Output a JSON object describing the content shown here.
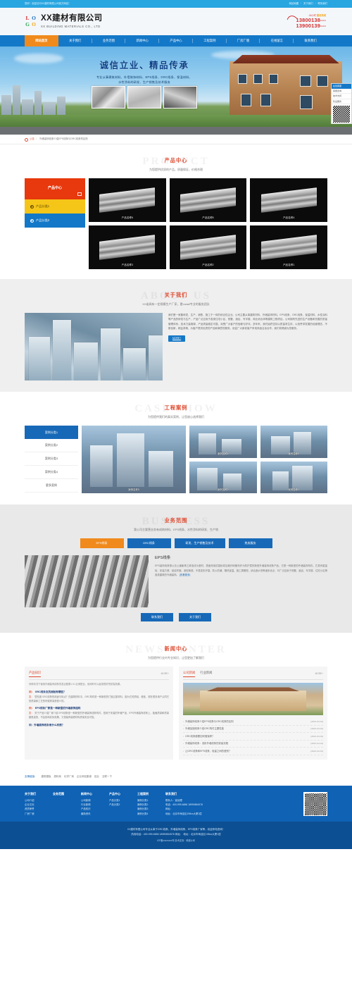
{
  "topbar": {
    "left": "您好！欢迎访问XX建材有限公司官方网站！",
    "links": [
      "网站地图",
      "关于我们",
      "联系我们"
    ]
  },
  "header": {
    "logo_letters": [
      "L",
      "O",
      "G",
      "O"
    ],
    "company_cn": "XX建材有限公司",
    "company_en": "XX BUILDING MATERIALS CO., LTD",
    "hotline_label_1": "24小时",
    "hotline_label_2": "服务热线",
    "hotline_1": "13800138---",
    "hotline_2": "13900139---"
  },
  "nav": [
    {
      "label": "网站首页",
      "active": true
    },
    {
      "label": "关于我们",
      "active": false
    },
    {
      "label": "业务范围",
      "active": false
    },
    {
      "label": "新闻中心",
      "active": false
    },
    {
      "label": "产品中心",
      "active": false
    },
    {
      "label": "工程案例",
      "active": false
    },
    {
      "label": "厂房厂貌",
      "active": false
    },
    {
      "label": "在线留言",
      "active": false
    },
    {
      "label": "联系我们",
      "active": false
    }
  ],
  "banner": {
    "title": "诚信立业、精品传承",
    "subtitle_1": "专业从事建筑材料、外墙装饰材料、EPS线条、GRC线条、保温材料、",
    "subtitle_2": "水性涂料的研发、生产销售及技术服务",
    "side_panel": {
      "header": "在线客服",
      "rows": [
        "客服咨询",
        "技术支持",
        "售后服务"
      ]
    }
  },
  "breadcrumb": {
    "tag": "公告",
    "text": "外墙装饰线条介绍EPS线条与GRC线条的区别"
  },
  "sections": {
    "product": {
      "watermark": "PRODUCT",
      "title": "产品中心",
      "subtitle": "为您提供优质的产品，质量保证，价格合理",
      "sidebar_main": "产品中心",
      "sidebar_items": [
        "产品分类1",
        "产品分类2"
      ],
      "items": [
        {
          "name": "产品名称6"
        },
        {
          "name": "产品名称5"
        },
        {
          "name": "产品名称4"
        },
        {
          "name": "产品名称3"
        },
        {
          "name": "产品名称2"
        },
        {
          "name": "产品名称1"
        }
      ]
    },
    "about": {
      "watermark": "ABOUT US",
      "title": "关于我们",
      "subtitle": "XX省具有一定规模生产厂家，更install专业的服务团队",
      "body": "我们是一家集研发、生产、销售、施工于一体的综合性企业。公司主要从事建筑材料、外墙装饰材料、EPS线条、GRC线条、保温材料、水性涂料等产品的研发与生产，产品广泛应用于各类住宅小区、别墅、酒店、写字楼、商业综合体等建筑工程项目。公司拥有先进的生产设备和完善的质量管理体系，技术力量雄厚，产品质量稳定可靠，深受广大客户的信赖与好评。多年来，我们始终坚持以质量求生存、以信誉求发展的经营理念，不断创新，精益求精，为客户提供优质的产品和满意的服务。欢迎广大新老客户来电来函洽谈合作，我们将竭诚为您服务。",
      "more": "MORE+"
    },
    "case": {
      "watermark": "CASE SHOW",
      "title": "工程案例",
      "subtitle": "为您提供我们的真实案例，让您放心选择我们",
      "sidebar_items": [
        "案例分类1",
        "案例分类2",
        "案例分类3",
        "案例分类4",
        "更多案例"
      ],
      "items": [
        {
          "name": "案例名称5"
        },
        {
          "name": "案例名称4"
        },
        {
          "name": "案例名称3"
        },
        {
          "name": "案例名称2"
        },
        {
          "name": "案例名称1"
        }
      ]
    },
    "business": {
      "watermark": "BUSINESS",
      "title": "业务范围",
      "subtitle": "我公司主要营业务有成筑材料、EPS线条、水性涂料的研发、生产销",
      "tabs": [
        {
          "label": "EPS线条",
          "active": true
        },
        {
          "label": "GRC线条",
          "active": false
        },
        {
          "label": "研发、生产销售及技术",
          "active": false
        },
        {
          "label": "热卖服务",
          "active": false
        }
      ],
      "detail_title": "EPS线条",
      "detail_body": "EPS装饰线条是以无公害聚苯乙烯泡沫为基材，表面采用抗裂砂浆加玻纤网格布作为防护层的新型外墙装饰线条产品，它是一种新型的外墙装饰构件。它具有重量轻、安装方便、粘结牢固、造型美观、不易变形开裂、防火防潮、隔热保温、施工周期短、综合造价低等诸多优点，可广泛应用于别墅、酒店、写字楼、住宅小区等各类建筑的外墙装饰。",
      "detail_more": "[查看更多]",
      "buttons": [
        "联系我们",
        "关于我们"
      ]
    },
    "news": {
      "watermark": "NEWS CENTER",
      "title": "新闻中心",
      "subtitle": "为您提供行业内专业知识，让您更加了解我们",
      "left": {
        "title": "产品知识",
        "more": "MORE+",
        "lead": "何种情况下使用外墙装饰线条的混合配置1.5:1比例配比，使用时可以起到很好的防裂效果。",
        "qa": [
          {
            "q_mark": "问：",
            "q": "GRC线条及抗测验有哪些？",
            "a_mark": "答：",
            "a": "您知道 GRC线条的用途与特点？在建筑材料中，GRC构件是一种新型的门窗过梁材料，因为它的质轻、便宜，现在很多用户认同它的质量和工艺的时候质量是很少的。"
          },
          {
            "q_mark": "问：",
            "q": "EPS线条厂家是一种新型的外墙装饰结构",
            "a_mark": "答：",
            "a": "关于产品介绍厂家介绍 EPS线条是一种新型的外墙装饰线条构件，是用于安装的外墙产品，EPS外墙装饰线条上，板面质量和质量都是高的，不会影响实际效果，又是装饰装修材料质量安全可靠。"
          }
        ],
        "question_more": "问：外墙装饰线条用什么材质？"
      },
      "right": {
        "tabs": [
          {
            "label": "公司新闻",
            "active": true
          },
          {
            "label": "行业新闻",
            "active": false
          }
        ],
        "more": "MORE+",
        "items": [
          {
            "title": "外墙装饰线条介绍EPS线条与GRC线条的区别",
            "date": "[2021-04-01]"
          },
          {
            "title": "外墙加固线条介绍GRC构件主要性能",
            "date": "[2021-04-01]"
          },
          {
            "title": "GRC线条都要如何做保养？",
            "date": "[2021-04-01]"
          },
          {
            "title": "外墙装饰线条：浅析外墙线条的安装流程",
            "date": "[2021-04-01]"
          },
          {
            "title": "让GRC线条和EPS线条、轻量之间的差别？",
            "date": "[2021-04-01]"
          }
        ]
      }
    }
  },
  "friendly_links": {
    "label": "友情链接：",
    "items": [
      "建筑模板",
      "原料商",
      "化学厂商",
      "企业网站集锦",
      "铝业",
      "互联一下"
    ]
  },
  "footer": {
    "columns": [
      {
        "title": "关于我们",
        "links": [
          "公司介绍",
          "企业文化",
          "资质荣誉",
          "厂房厂貌"
        ]
      },
      {
        "title": "业务范围",
        "links": []
      },
      {
        "title": "新闻中心",
        "links": [
          "公司新闻",
          "行业新闻",
          "产品知识",
          "最新资讯"
        ]
      },
      {
        "title": "产品中心",
        "links": [
          "产品分类1",
          "产品分类2"
        ]
      },
      {
        "title": "工程案例",
        "links": [
          "案例分类1",
          "案例分类2",
          "案例分类3",
          "案例分类4"
        ]
      }
    ],
    "contact": {
      "title": "联系我们",
      "rows": [
        "联系人：宣经理",
        "电话：400-999-6656   18990854576",
        "网址：",
        "地址：北京市海淀区198xx大厦1层"
      ]
    }
  },
  "copyright": {
    "line1": "XX建材有限公司专业从事于GRC线条、外墙装饰线条、EPS线条厂家等，欢迎来电咨询！",
    "line2": "热线电话：400-999-6656   18990854576  网址：    地址：北京市海淀区198xx大厦1层",
    "line3": "ICP备xxxxxxxx号  技术支持：科唐公司"
  }
}
